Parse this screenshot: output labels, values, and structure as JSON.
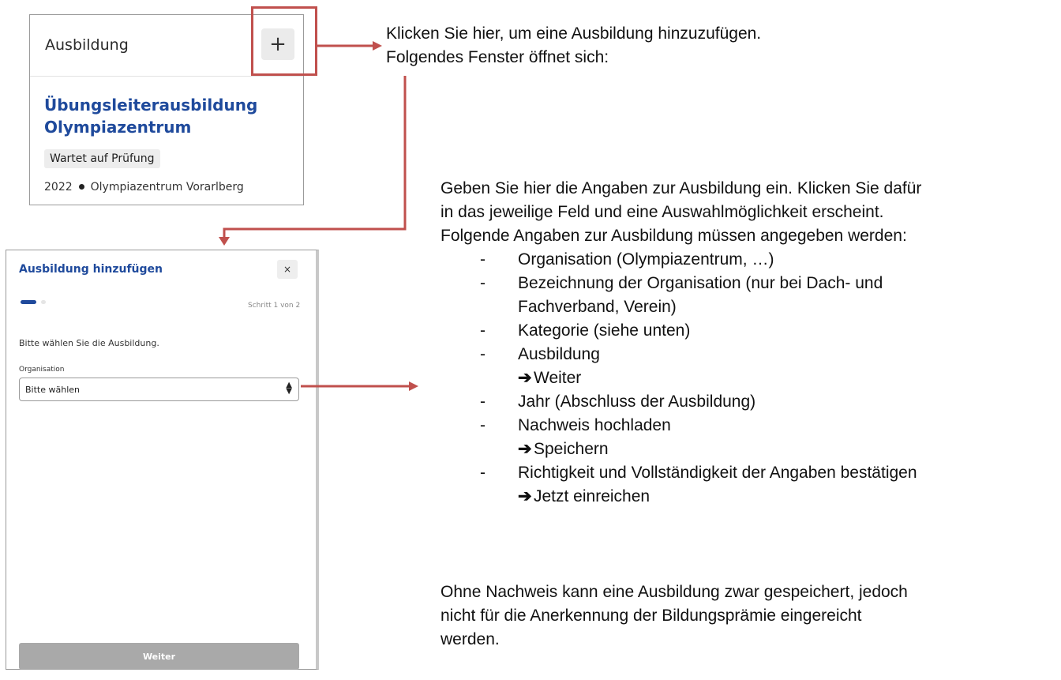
{
  "card": {
    "title": "Ausbildung",
    "add_button_label": "+",
    "course_title": "Übungsleiterausbildung Olympiazentrum",
    "status_badge": "Wartet auf Prüfung",
    "year": "2022",
    "location": "Olympiazentrum Vorarlberg"
  },
  "dialog": {
    "title": "Ausbildung hinzufügen",
    "close_label": "×",
    "step_text": "Schritt 1 von 2",
    "prompt": "Bitte wählen Sie die Ausbildung.",
    "field_label": "Organisation",
    "select_value": "Bitte wählen",
    "next_button": "Weiter"
  },
  "instructions": {
    "top_line1": "Klicken Sie hier, um eine Ausbildung hinzuzufügen.",
    "top_line2": "Folgendes Fenster öffnet sich:",
    "intro_line1": "Geben Sie hier die Angaben zur Ausbildung ein. Klicken Sie dafür",
    "intro_line2": "in das jeweilige Feld und eine Auswahlmöglichkeit erscheint.",
    "intro_line3": "Folgende Angaben zur Ausbildung müssen angegeben werden:",
    "items": [
      "Organisation (Olympiazentrum, …)",
      "Bezeichnung der Organisation (nur bei Dach- und",
      "Fachverband, Verein)",
      "Kategorie (siehe unten)",
      "Ausbildung",
      "Weiter",
      "Jahr (Abschluss der Ausbildung)",
      "Nachweis hochladen",
      "Speichern",
      "Richtigkeit und Vollständigkeit der Angaben bestätigen",
      "Jetzt einreichen"
    ],
    "dash": "-",
    "arrow": "➔",
    "closing_line1": "Ohne Nachweis kann eine Ausbildung zwar gespeichert, jedoch",
    "closing_line2": "nicht für die Anerkennung der Bildungsprämie eingereicht",
    "closing_line3": "werden."
  },
  "colors": {
    "highlight": "#c0504d",
    "brand_blue": "#1f4a9c",
    "disabled_button": "#a9a9a9"
  }
}
